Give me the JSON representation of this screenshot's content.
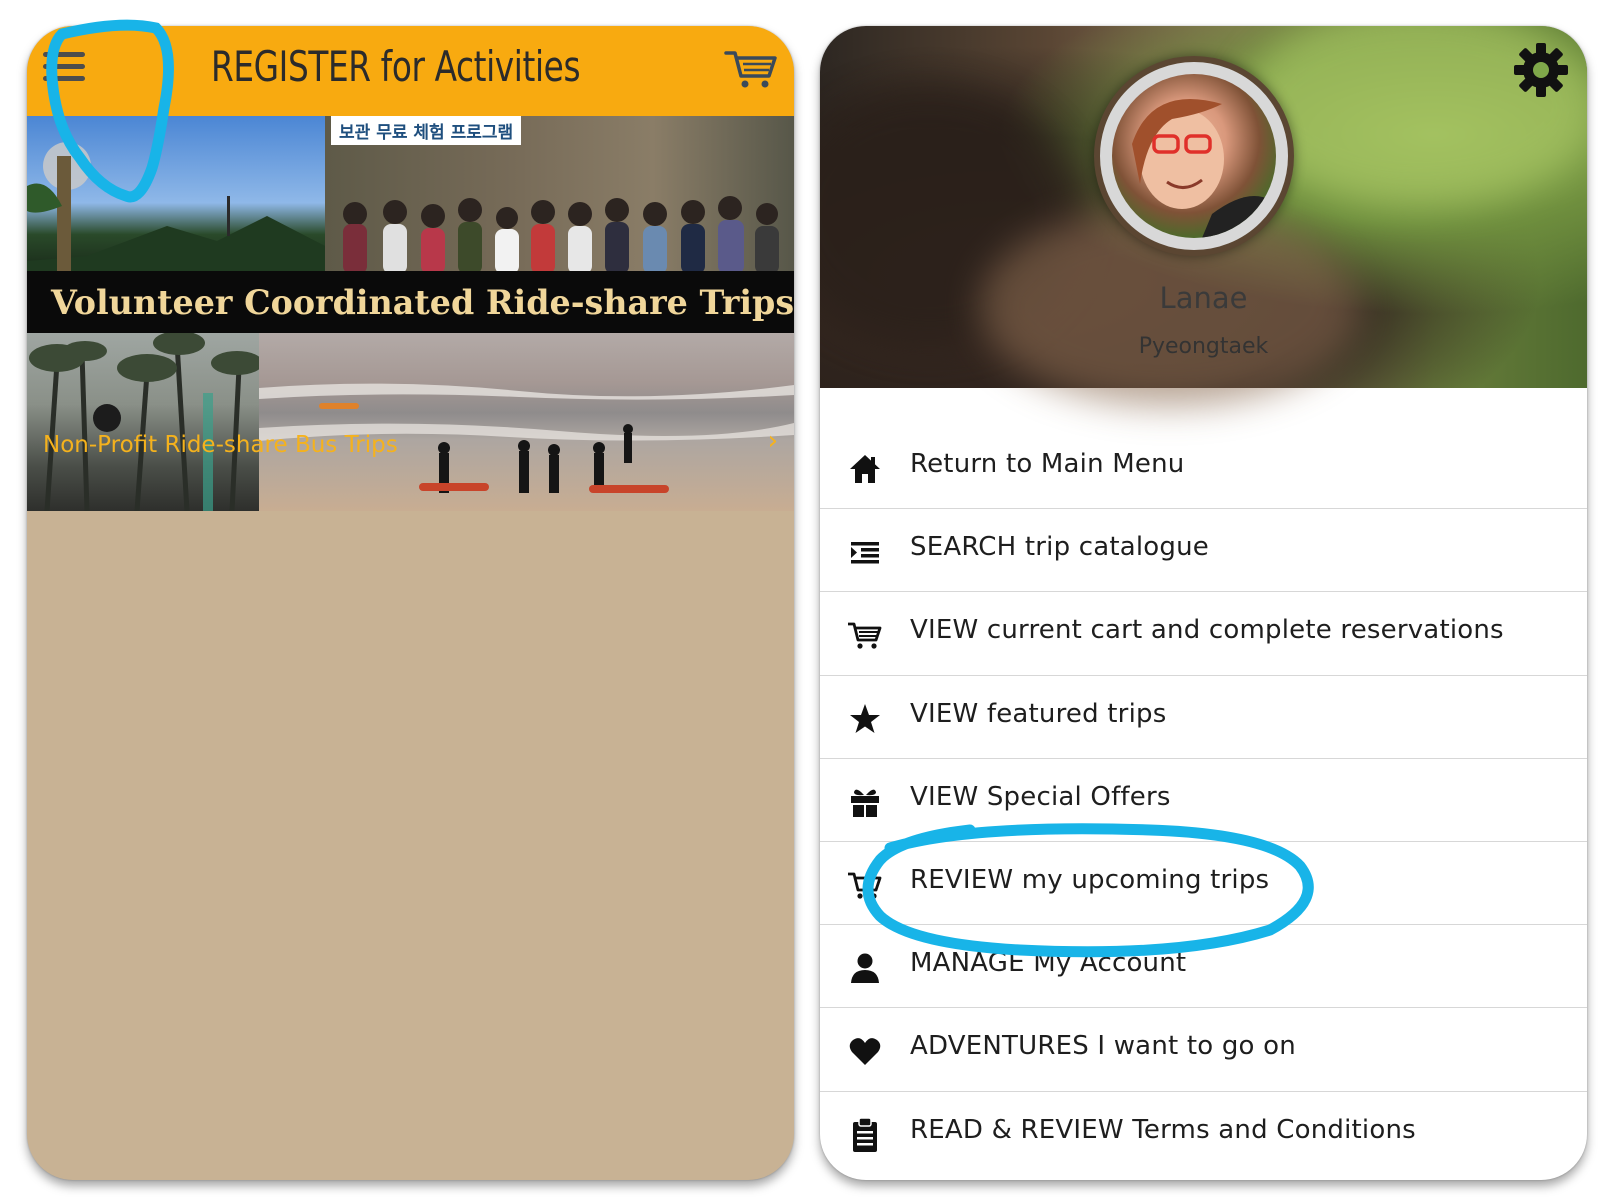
{
  "left_screen": {
    "header": {
      "title": "REGISTER for Activities",
      "cart_icon": "cart-icon",
      "menu_icon": "hamburger-icon"
    },
    "banner": {
      "sign_text": "보관 무료 체험 프로그램",
      "title": "Volunteer Coordinated Ride-share Trips"
    },
    "tile": {
      "caption": "Non-Profit Ride-share Bus Trips",
      "chevron": "›"
    },
    "colors": {
      "header_bg": "#f8aa10",
      "caption": "#f5b21d",
      "background": "#c8b294"
    }
  },
  "right_screen": {
    "profile": {
      "name": "Lanae",
      "location": "Pyeongtaek",
      "settings_icon": "gear-icon"
    },
    "menu": [
      {
        "label": "Return to Main Menu",
        "icon": "home-icon"
      },
      {
        "label": "SEARCH trip catalogue",
        "icon": "list-indent-icon"
      },
      {
        "label": "VIEW current cart and complete reservations",
        "icon": "cart-icon"
      },
      {
        "label": "VIEW featured trips",
        "icon": "star-icon"
      },
      {
        "label": "VIEW Special Offers",
        "icon": "gift-icon"
      },
      {
        "label": "REVIEW my upcoming trips",
        "icon": "cart-icon"
      },
      {
        "label": "MANAGE My Account",
        "icon": "user-icon"
      },
      {
        "label": "ADVENTURES I want to go on",
        "icon": "heart-icon"
      },
      {
        "label": "READ & REVIEW Terms and Conditions",
        "icon": "clipboard-icon"
      }
    ]
  },
  "annotation_color": "#18b4e8"
}
